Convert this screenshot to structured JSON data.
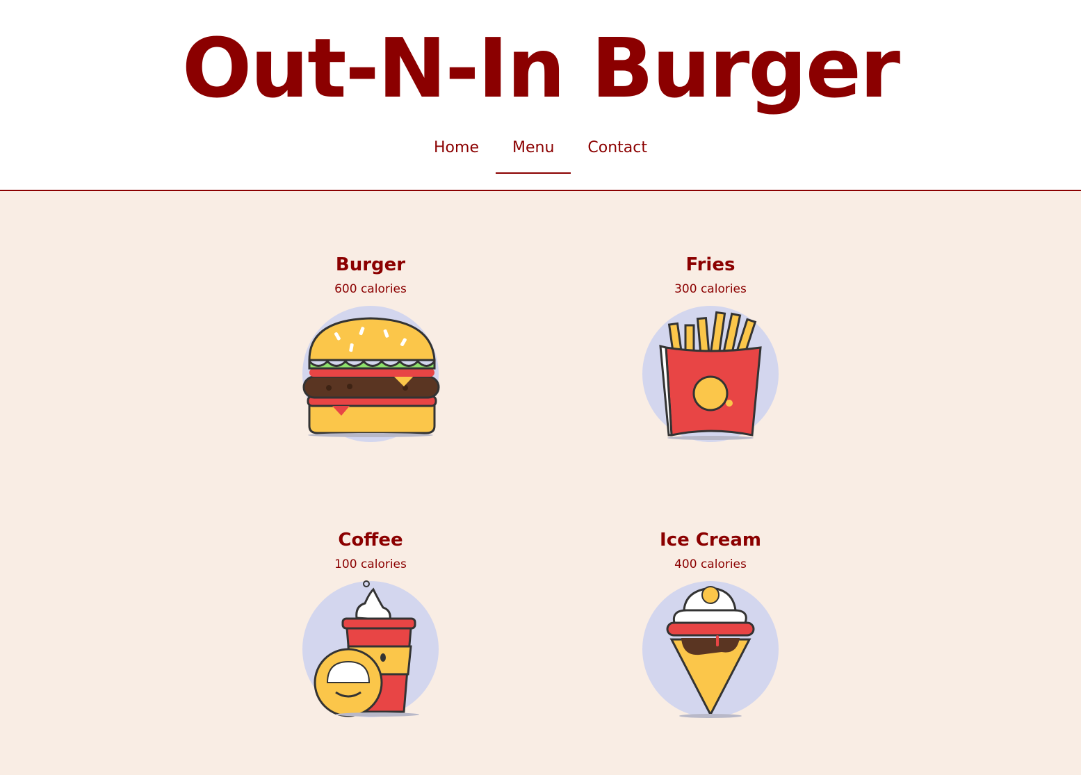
{
  "site": {
    "title": "Out-N-In Burger"
  },
  "nav": {
    "items": [
      {
        "label": "Home",
        "active": false
      },
      {
        "label": "Menu",
        "active": true
      },
      {
        "label": "Contact",
        "active": false
      }
    ]
  },
  "menu": {
    "items": [
      {
        "name": "Burger",
        "calories": "600 calories",
        "icon": "burger-illustration"
      },
      {
        "name": "Fries",
        "calories": "300 calories",
        "icon": "fries-illustration"
      },
      {
        "name": "Coffee",
        "calories": "100 calories",
        "icon": "coffee-illustration"
      },
      {
        "name": "Ice Cream",
        "calories": "400 calories",
        "icon": "ice-cream-illustration"
      }
    ]
  },
  "colors": {
    "brand": "#8b0000",
    "background": "#f9ede4",
    "header_background": "#ffffff",
    "image_circle": "#d3d6ee"
  }
}
